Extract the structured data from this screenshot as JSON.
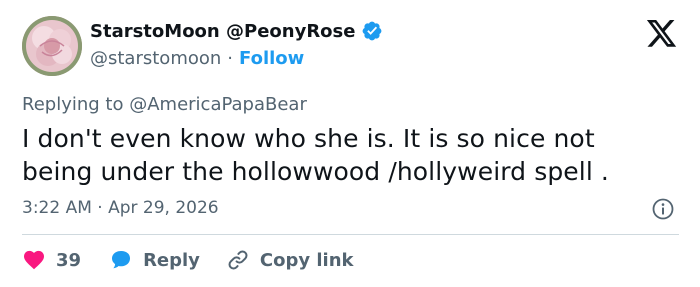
{
  "colors": {
    "accent": "#1d9bf0",
    "text": "#0f1419",
    "muted": "#536471",
    "heart": "#f91880",
    "divider": "#cfd9de"
  },
  "author": {
    "display_name": "StarstoMoon @PeonyRose",
    "handle": "@starstomoon",
    "separator": "·",
    "follow_label": "Follow",
    "verified_icon": "verified-badge-icon",
    "avatar": "peony-flower-avatar"
  },
  "reply_context": {
    "prefix": "Replying to",
    "mention": "@AmericaPapaBear"
  },
  "tweet": {
    "text": "I don't even know who she is. It is so nice not being under the hollowwood /hollyweird spell ."
  },
  "meta": {
    "timestamp": "3:22 AM · Apr 29, 2026"
  },
  "actions": {
    "like_count": "39",
    "reply_label": "Reply",
    "copy_link_label": "Copy link"
  },
  "icons": {
    "brand": "x-logo-icon",
    "info": "info-icon",
    "like": "heart-icon",
    "reply": "speech-bubble-icon",
    "copy": "link-icon"
  }
}
